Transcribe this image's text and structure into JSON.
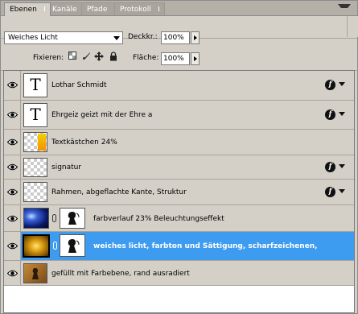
{
  "tabs": [
    {
      "label": "Ebenen",
      "active": true
    },
    {
      "label": "Kanäle",
      "active": false
    },
    {
      "label": "Pfade",
      "active": false
    },
    {
      "label": "Protokoll",
      "active": false
    }
  ],
  "options": {
    "blend_mode": "Weiches Licht",
    "opacity_label": "Deckkr.:",
    "opacity_value": "100%",
    "lock_label": "Fixieren:",
    "fill_label": "Fläche:",
    "fill_value": "100%"
  },
  "layers": [
    {
      "name": "Lothar Schmidt",
      "type": "text",
      "thumb": "T",
      "fx": true,
      "selected": false
    },
    {
      "name": "Ehrgeiz geizt  mit der  Ehre a",
      "type": "text",
      "thumb": "T",
      "fx": true,
      "selected": false
    },
    {
      "name": "Textkästchen 24%",
      "type": "raster",
      "fx": false,
      "selected": false
    },
    {
      "name": "signatur",
      "type": "raster",
      "fx": true,
      "selected": false
    },
    {
      "name": "Rahmen, abgeflachte Kante, Struktur",
      "type": "raster",
      "fx": true,
      "selected": false
    },
    {
      "name": "farbverlauf 23% Beleuchtungseffekt",
      "type": "masked",
      "fx": false,
      "selected": false
    },
    {
      "name": "weiches licht, farbton und Sättigung, scharfzeichenen,",
      "type": "masked",
      "fx": false,
      "selected": true
    },
    {
      "name": "gefüllt mit Farbebene, rand ausradiert",
      "type": "raster",
      "fx": false,
      "selected": false
    }
  ],
  "colors": {
    "selection": "#3d9cf0",
    "panel": "#d4d0c8"
  },
  "icons": [
    "eye-icon",
    "fx-icon",
    "chain-link-icon",
    "lock-transparency-icon",
    "lock-brush-icon",
    "lock-move-icon",
    "lock-all-icon",
    "panel-menu-icon"
  ]
}
